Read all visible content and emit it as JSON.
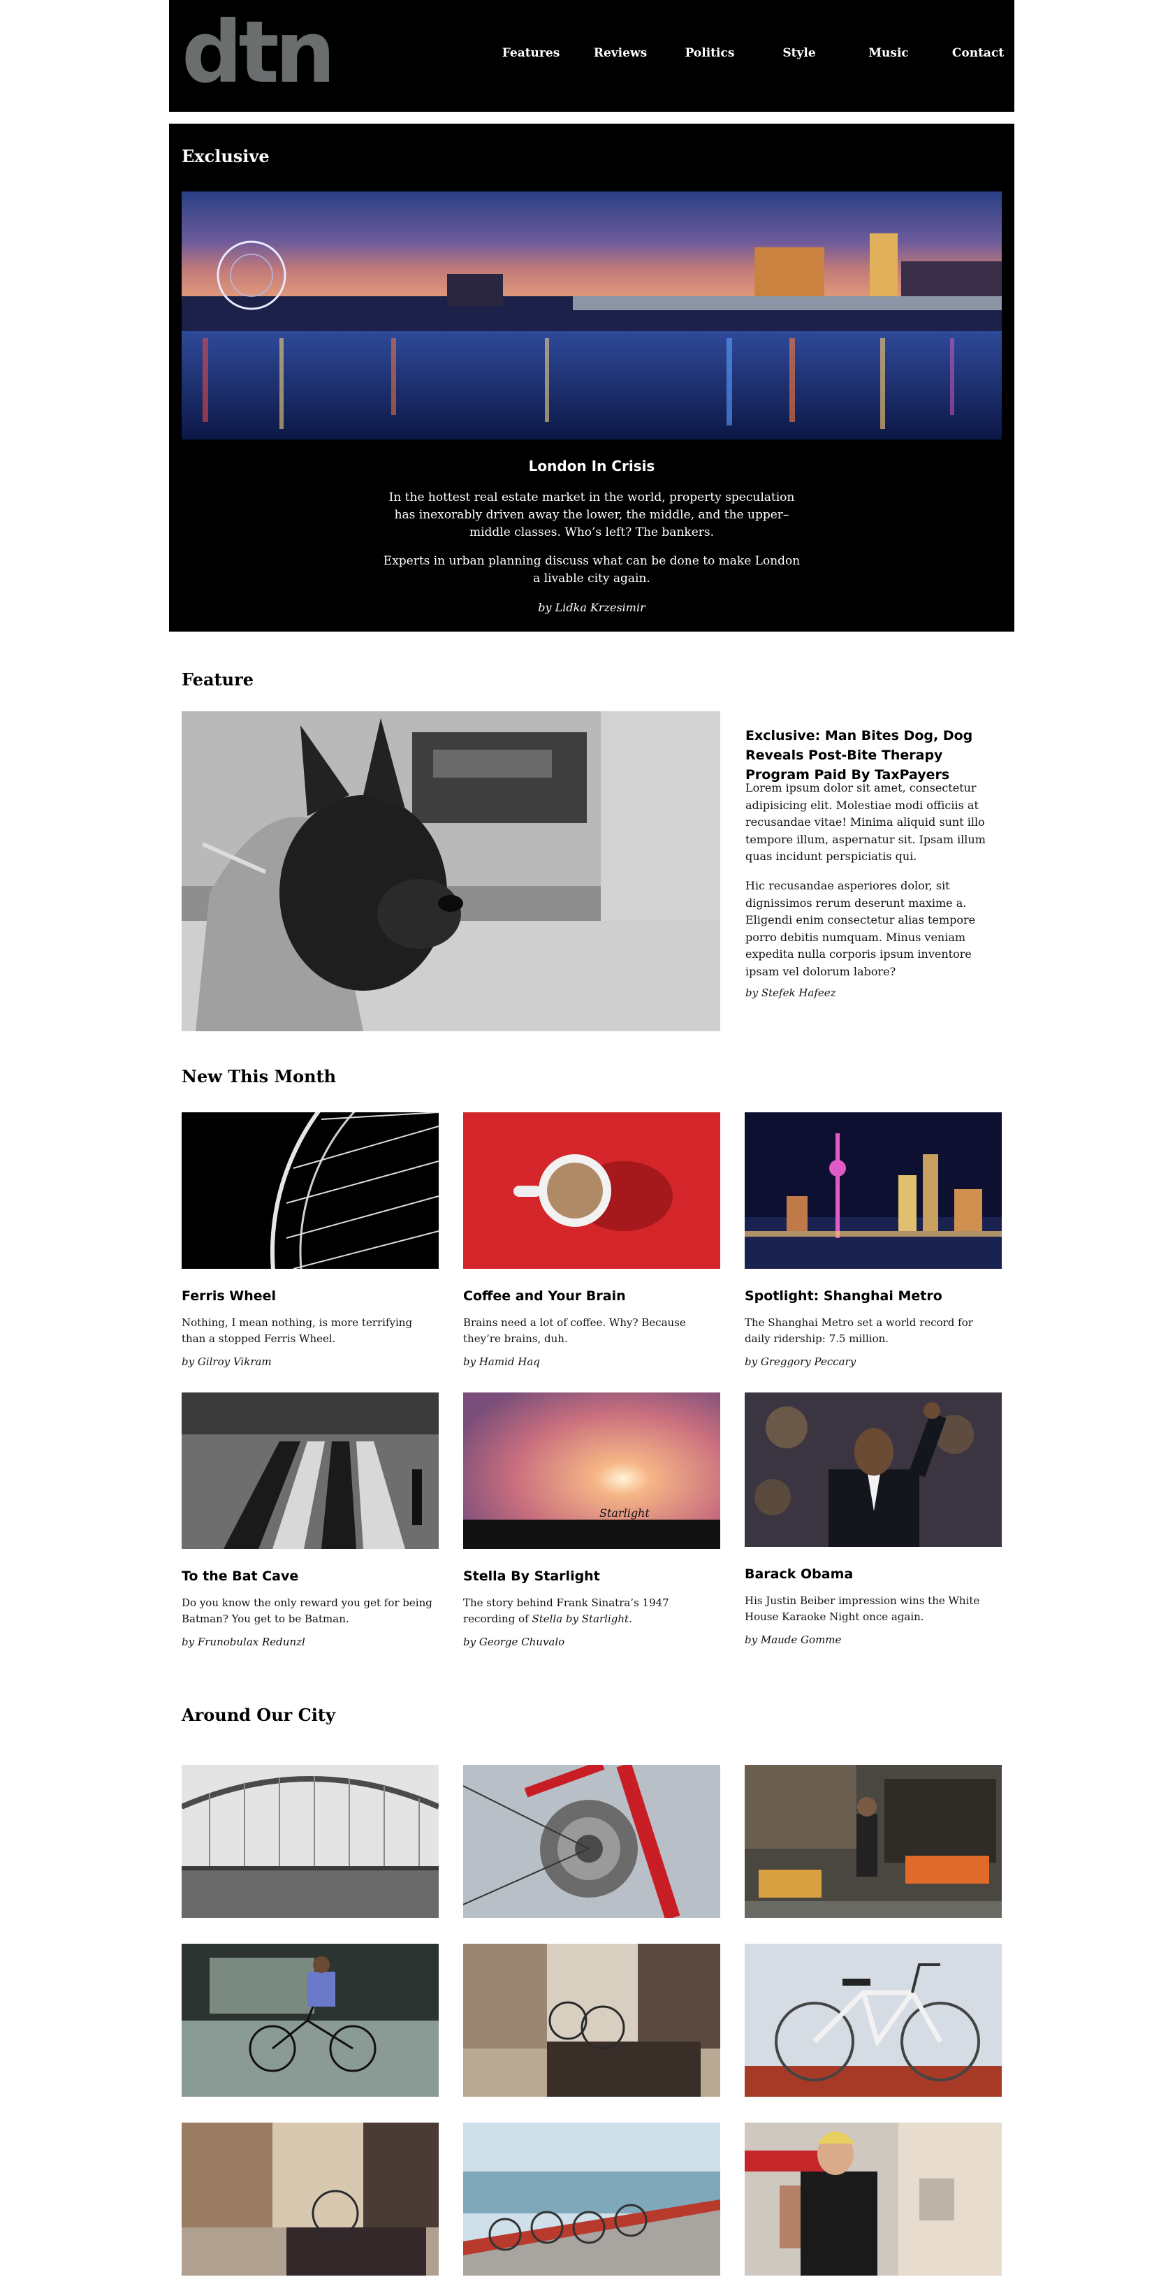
{
  "header": {
    "logo": "dtn",
    "nav": [
      "Features",
      "Reviews",
      "Politics",
      "Style",
      "Music",
      "Contact"
    ]
  },
  "exclusive": {
    "heading": "Exclusive",
    "title": "London In Crisis",
    "paragraphs": [
      "In the hottest real estate market in the world, property speculation has inexorably driven away the lower, the middle, and the upper–middle classes. Who’s left? The bankers.",
      "Experts in urban planning discuss what can be done to make London a livable city again."
    ],
    "byline": "by Lidka Krzesimir"
  },
  "feature": {
    "heading": "Feature",
    "title": "Exclusive: Man Bites Dog, Dog Reveals Post-Bite Therapy Program Paid By TaxPayers",
    "paragraphs": [
      "Lorem ipsum dolor sit amet, consectetur adipisicing elit. Molestiae modi officiis at recusandae vitae! Minima aliquid sunt illo tempore illum, aspernatur sit. Ipsam illum quas incidunt perspiciatis qui.",
      "Hic recusandae asperiores dolor, sit dignissimos rerum deserunt maxime a. Eligendi enim consectetur alias tempore porro debitis numquam. Minus veniam expedita nulla corporis ipsum inventore ipsam vel dolorum labore?"
    ],
    "byline": "by Stefek Hafeez"
  },
  "new_this_month": {
    "heading": "New This Month",
    "cards": [
      {
        "title": "Ferris Wheel",
        "text": "Nothing, I mean nothing, is more terrifying than a stopped Ferris Wheel.",
        "byline": "by Gilroy Vikram"
      },
      {
        "title": "Coffee and Your Brain",
        "text": "Brains need a lot of coffee. Why? Because they’re brains, duh.",
        "byline": "by Hamid Haq"
      },
      {
        "title": "Spotlight: Shanghai Metro",
        "text": "The Shanghai Metro set a world record for daily ridership: 7.5 million.",
        "byline": "by Greggory Peccary"
      },
      {
        "title": "To the Bat Cave",
        "text": "Do you know the only reward you get for being Batman? You get to be Batman.",
        "byline": "by Frunobulax Redunzl"
      },
      {
        "title": "Stella By Starlight",
        "text_prefix": "The story behind Frank Sinatra’s 1947 recording of ",
        "text_em": "Stella by Starlight.",
        "byline": "by George Chuvalo"
      },
      {
        "title": "Barack Obama",
        "text": "His Justin Beiber impression wins the White House Karaoke Night once again.",
        "byline": "by Maude Gomme"
      }
    ]
  },
  "around_city": {
    "heading": "Around Our City"
  },
  "image_text": {
    "starlight": "Starlight"
  }
}
